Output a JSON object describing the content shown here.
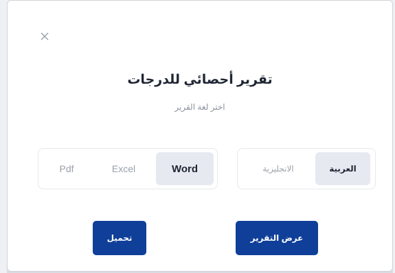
{
  "modal": {
    "close_icon": "close-icon",
    "title": "تقرير أحصائي للدرجات",
    "subtitle": "اختر لغة القرير"
  },
  "format_selector": {
    "options": [
      "Pdf",
      "Excel",
      "Word"
    ],
    "selected": "Word"
  },
  "language_selector": {
    "options": [
      "الانجليزية",
      "العربية"
    ],
    "selected": "العربية"
  },
  "actions": {
    "download_label": "تحميل",
    "view_report_label": "عرض التقرير"
  },
  "colors": {
    "primary": "#0f3f99",
    "selected_bg": "#e6e9f0",
    "muted_text": "#9aa0aa",
    "title_text": "#1f2533"
  }
}
